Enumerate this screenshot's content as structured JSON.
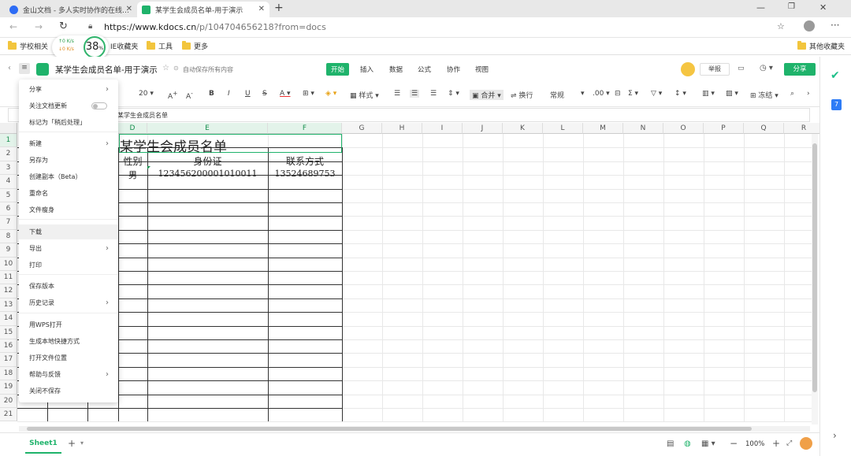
{
  "browser": {
    "tabs": [
      {
        "title": "金山文档 - 多人实时协作的在线…",
        "active": false
      },
      {
        "title": "某学生会成员名单-用于演示",
        "active": true
      }
    ],
    "new_tab": "+",
    "url_host": "https://www.kdocs.cn",
    "url_path": "/p/104704656218?from=docs",
    "bookmarks": [
      "学校相关",
      "IE收藏夹",
      "工具",
      "更多"
    ],
    "other_bookmarks": "其他收藏夹",
    "net_speed_up": "↑0  K/s",
    "net_speed_down": "↓0  K/s",
    "net_percent": "38",
    "net_percent_unit": "%"
  },
  "app": {
    "doc_title": "某学生会成员名单-用于演示",
    "autosave": "自动保存所有内容",
    "menu_tabs": [
      "开始",
      "插入",
      "数据",
      "公式",
      "协作",
      "视图"
    ],
    "active_menu_tab": "开始",
    "report_button": "举报",
    "share_button": "分享",
    "font_size": "20",
    "ribbon": {
      "style": "样式",
      "merge": "合并",
      "wrap": "换行",
      "format": "常规",
      "freeze": "冻结"
    },
    "formula_content": "某学生会成员名单"
  },
  "menu": {
    "items": [
      {
        "label": "分享",
        "arrow": true
      },
      {
        "label": "关注文档更新",
        "toggle": true
      },
      {
        "label": "标记为「稍后处理」"
      },
      {
        "label": "新建",
        "arrow": true
      },
      {
        "label": "另存为"
      },
      {
        "label": "创建副本（Beta）"
      },
      {
        "label": "重命名"
      },
      {
        "label": "文件瘦身"
      },
      {
        "label": "下载",
        "highlight": true
      },
      {
        "label": "导出",
        "arrow": true
      },
      {
        "label": "打印"
      },
      {
        "label": "保存版本"
      },
      {
        "label": "历史记录",
        "arrow": true
      },
      {
        "label": "用WPS打开"
      },
      {
        "label": "生成本地快捷方式"
      },
      {
        "label": "打开文件位置"
      },
      {
        "label": "帮助与反馈",
        "arrow": true
      },
      {
        "label": "关闭不保存"
      }
    ]
  },
  "sheet": {
    "columns": [
      "D",
      "E",
      "F",
      "G",
      "H",
      "I",
      "J",
      "K",
      "L",
      "M",
      "N",
      "O",
      "P",
      "Q",
      "R"
    ],
    "rows": [
      "1",
      "2",
      "3",
      "4",
      "5",
      "6",
      "7",
      "8",
      "9",
      "10",
      "11",
      "12",
      "13",
      "14",
      "15",
      "16",
      "17",
      "18",
      "19",
      "20",
      "21"
    ],
    "title_cell": "某学生会成员名单",
    "headers": {
      "gender": "性别",
      "id": "身份证",
      "contact": "联系方式"
    },
    "row3": {
      "gender": "男",
      "id": "123456200001010011",
      "contact": "13524689753"
    }
  },
  "status": {
    "sheet_tab": "Sheet1",
    "zoom": "100%"
  }
}
